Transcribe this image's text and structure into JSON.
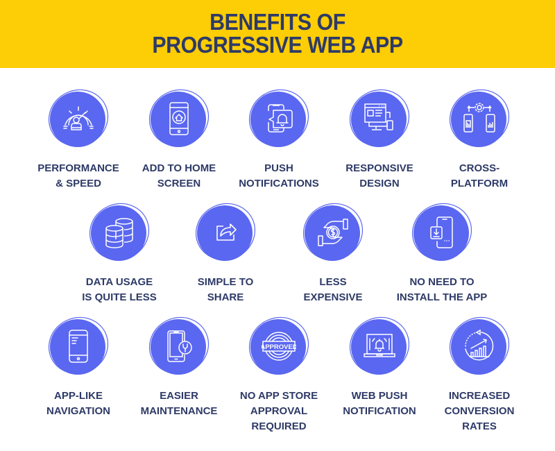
{
  "header": {
    "title_line1": "BENEFITS OF",
    "title_line2": "PROGRESSIVE WEB APP",
    "background_color": "#fdcd05",
    "text_color": "#2e3a67"
  },
  "accent_color": "#5a67f0",
  "benefits": [
    {
      "icon": "speedometer-icon",
      "line1": "PERFORMANCE",
      "line2": "& SPEED",
      "line3": ""
    },
    {
      "icon": "home-screen-phone-icon",
      "line1": "ADD TO HOME",
      "line2": "SCREEN",
      "line3": ""
    },
    {
      "icon": "push-notification-icon",
      "line1": "PUSH",
      "line2": "NOTIFICATIONS",
      "line3": ""
    },
    {
      "icon": "responsive-devices-icon",
      "line1": "RESPONSIVE",
      "line2": "DESIGN",
      "line3": ""
    },
    {
      "icon": "cross-platform-icon",
      "line1": "CROSS-",
      "line2": "PLATFORM",
      "line3": ""
    },
    {
      "icon": "database-icon",
      "line1": "DATA USAGE",
      "line2": "IS QUITE LESS",
      "line3": ""
    },
    {
      "icon": "share-icon",
      "line1": "SIMPLE TO",
      "line2": "SHARE",
      "line3": ""
    },
    {
      "icon": "money-hands-icon",
      "line1": "LESS",
      "line2": "EXPENSIVE",
      "line3": ""
    },
    {
      "icon": "download-phone-icon",
      "line1": "NO NEED TO",
      "line2": "INSTALL THE APP",
      "line3": ""
    },
    {
      "icon": "smartphone-icon",
      "line1": "APP-LIKE",
      "line2": "NAVIGATION",
      "line3": ""
    },
    {
      "icon": "phone-wrench-icon",
      "line1": "EASIER",
      "line2": "MAINTENANCE",
      "line3": ""
    },
    {
      "icon": "approved-stamp-icon",
      "line1": "NO APP STORE",
      "line2": "APPROVAL",
      "line3": "REQUIRED",
      "stamp_text": "APPROVED"
    },
    {
      "icon": "laptop-bell-icon",
      "line1": "WEB PUSH",
      "line2": "NOTIFICATION",
      "line3": ""
    },
    {
      "icon": "growth-chart-icon",
      "line1": "INCREASED",
      "line2": "CONVERSION",
      "line3": "RATES"
    }
  ]
}
